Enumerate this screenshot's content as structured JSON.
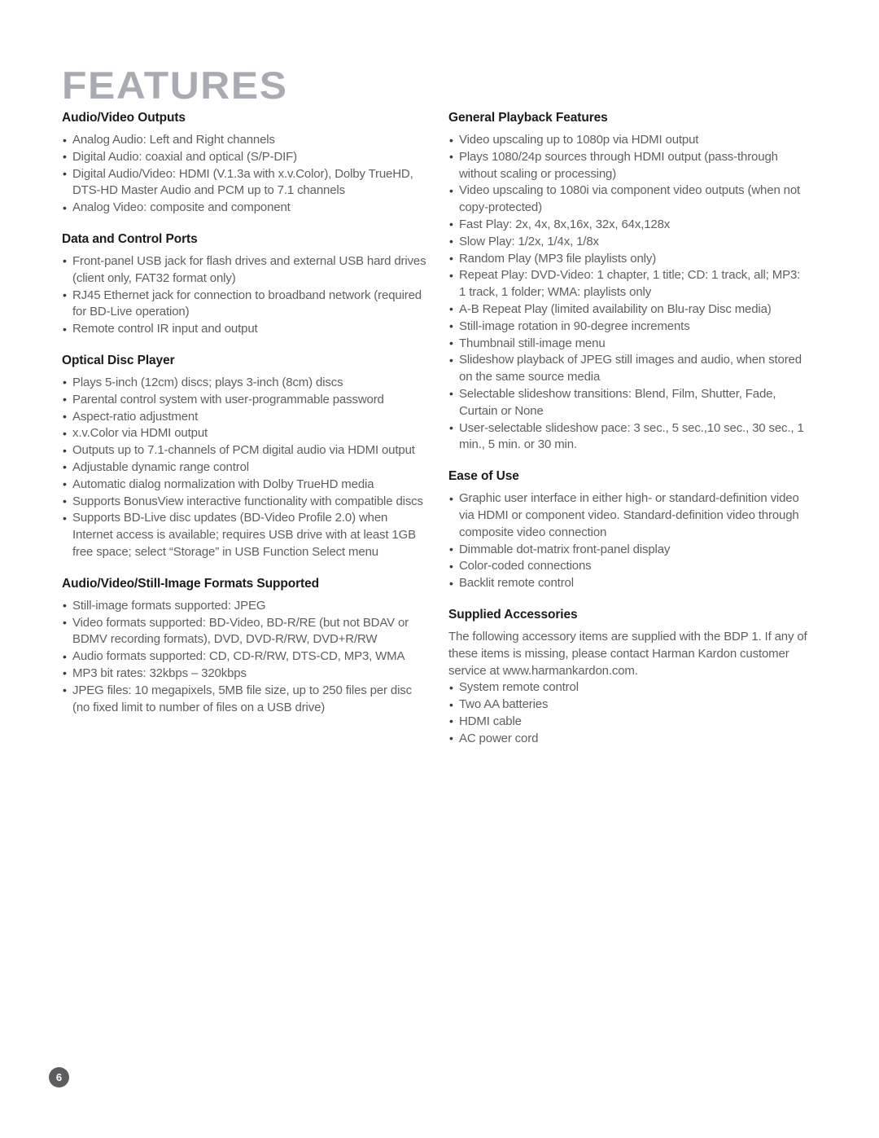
{
  "document": {
    "title": "FEATURES",
    "page_number": "6"
  },
  "left_column": {
    "sections": [
      {
        "heading": "Audio/Video Outputs",
        "bullets": [
          "Analog Audio: Left and Right channels",
          "Digital Audio: coaxial and optical (S/P-DIF)",
          "Digital Audio/Video: HDMI (V.1.3a with x.v.Color), Dolby TrueHD, DTS-HD Master Audio and PCM up to 7.1 channels",
          "Analog Video: composite and component"
        ]
      },
      {
        "heading": "Data and Control Ports",
        "bullets": [
          "Front-panel USB jack for flash drives and external USB hard drives (client only, FAT32 format only)",
          "RJ45 Ethernet jack for connection to broadband network (required for BD-Live operation)",
          "Remote control IR input and output"
        ]
      },
      {
        "heading": "Optical Disc Player",
        "bullets": [
          "Plays 5-inch (12cm) discs; plays 3-inch (8cm) discs",
          "Parental control system with user-programmable password",
          "Aspect-ratio adjustment",
          "x.v.Color via HDMI output",
          "Outputs up to 7.1-channels of PCM digital audio via HDMI output",
          "Adjustable dynamic range control",
          "Automatic dialog normalization with Dolby TrueHD media",
          "Supports BonusView interactive functionality with compatible discs",
          "Supports BD-Live disc updates (BD-Video Profile 2.0) when Internet access is available; requires USB drive with at least 1GB free space; select “Storage” in USB Function Select menu"
        ]
      },
      {
        "heading": "Audio/Video/Still-Image Formats Supported",
        "bullets": [
          "Still-image formats supported: JPEG",
          "Video formats supported: BD-Video, BD-R/RE (but not BDAV or BDMV recording formats), DVD, DVD-R/RW, DVD+R/RW",
          "Audio formats supported: CD, CD-R/RW, DTS-CD, MP3, WMA",
          "MP3 bit rates: 32kbps – 320kbps",
          "JPEG files: 10 megapixels, 5MB file size, up to 250 files per disc (no fixed limit to number of files on a USB drive)"
        ]
      }
    ]
  },
  "right_column": {
    "sections": [
      {
        "heading": "General Playback Features",
        "bullets": [
          "Video upscaling up to 1080p via HDMI output",
          "Plays 1080/24p sources through HDMI output (pass-through without scaling or processing)",
          "Video upscaling to 1080i via component video outputs (when not copy-protected)",
          "Fast Play: 2x, 4x, 8x,16x, 32x, 64x,128x",
          "Slow Play: 1/2x, 1/4x, 1/8x",
          "Random Play (MP3 file playlists only)",
          "Repeat Play: DVD-Video: 1 chapter, 1 title; CD: 1 track, all; MP3: 1 track, 1 folder; WMA: playlists only",
          "A-B Repeat Play (limited availability on Blu-ray Disc media)",
          "Still-image rotation in 90-degree increments",
          "Thumbnail still-image menu",
          "Slideshow playback of JPEG still images and audio, when stored on the same source media",
          "Selectable slideshow transitions: Blend, Film, Shutter, Fade, Curtain or None",
          "User-selectable slideshow pace: 3 sec., 5 sec.,10 sec., 30 sec., 1 min., 5 min. or 30 min."
        ]
      },
      {
        "heading": "Ease of Use",
        "bullets": [
          "Graphic user interface in either high- or standard-definition video via HDMI or component video. Standard-definition video through composite video connection",
          "Dimmable dot-matrix front-panel display",
          "Color-coded connections",
          "Backlit remote control"
        ]
      },
      {
        "heading": "Supplied Accessories",
        "intro": "The following accessory items are supplied with the BDP 1. If any of these items is missing, please contact Harman Kardon customer service at www.harmankardon.com.",
        "bullets": [
          "System remote control",
          "Two AA batteries",
          "HDMI cable",
          "AC power cord"
        ]
      }
    ]
  },
  "colors": {
    "title": "#a9abb2",
    "heading": "#1b1b1b",
    "body": "#5f5f61",
    "badge_background": "#5d5d5f",
    "badge_text": "#ffffff"
  }
}
